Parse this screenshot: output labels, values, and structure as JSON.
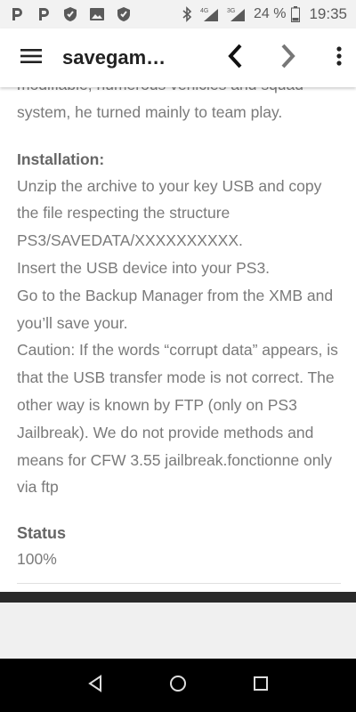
{
  "statusbar": {
    "network_tags": [
      "4G",
      "3G"
    ],
    "battery_percent": "24 %",
    "time": "19:35"
  },
  "appbar": {
    "title": "savegam…"
  },
  "content": {
    "intro_tail": "modifiable, numerous vehicles and squad system, he turned mainly to team play.",
    "installation_heading": "Installation:",
    "installation_lines": [
      "Unzip the archive to your key USB and copy the file respecting the structure PS3/SAVEDATA/XXXXXXXXXX.",
      "Insert the USB device into your PS3.",
      "Go to the Backup Manager from the XMB and you’ll save your.",
      "Caution: If the words “corrupt data” appears, is that the USB transfer mode is not correct. The other way is known by FTP (only on PS3 Jailbreak). We do not provide methods and means for CFW 3.55 jailbreak.fonctionne only via ftp"
    ],
    "status_heading": "Status",
    "status_value": "100%"
  },
  "icons": {
    "menu": "hamburger-menu-icon",
    "back": "chevron-left-icon",
    "forward": "chevron-right-icon",
    "more": "more-vert-icon"
  }
}
